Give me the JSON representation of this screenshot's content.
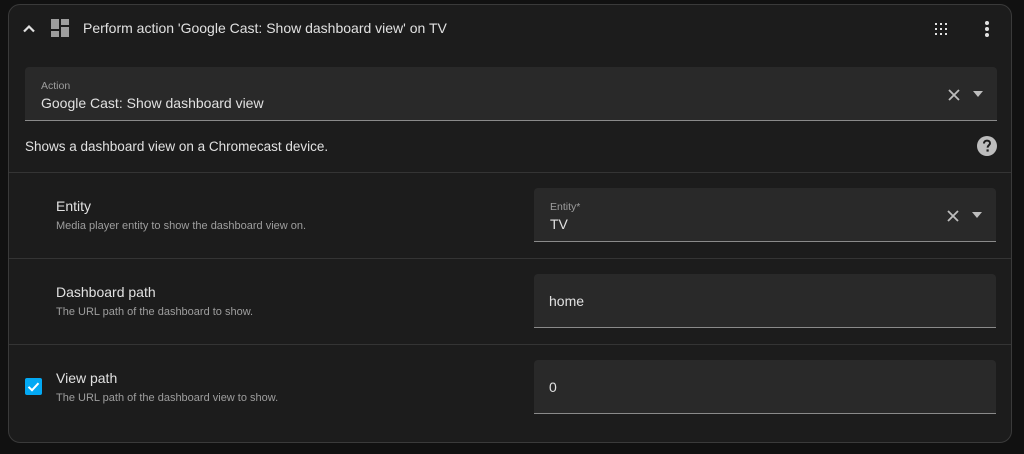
{
  "header": {
    "title": "Perform action 'Google Cast: Show dashboard view' on TV"
  },
  "action_field": {
    "label": "Action",
    "value": "Google Cast: Show dashboard view"
  },
  "description": "Shows a dashboard view on a Chromecast device.",
  "fields": [
    {
      "title": "Entity",
      "subtitle": "Media player entity to show the dashboard view on.",
      "input_label": "Entity*",
      "input_value": "TV"
    },
    {
      "title": "Dashboard path",
      "subtitle": "The URL path of the dashboard to show.",
      "input_value": "home"
    },
    {
      "title": "View path",
      "subtitle": "The URL path of the dashboard view to show.",
      "input_value": "0",
      "checked": true
    }
  ],
  "colors": {
    "accent": "#03a9f4",
    "card_bg": "#1c1c1c",
    "field_bg": "#292929"
  },
  "icons": {
    "collapse": "chevron-up-icon",
    "type": "dashboard-icon",
    "drag": "drag-handle-icon",
    "menu": "dots-vertical-icon",
    "clear": "close-icon",
    "dropdown": "menu-down-icon",
    "help": "help-circle-icon",
    "check": "check-icon"
  }
}
